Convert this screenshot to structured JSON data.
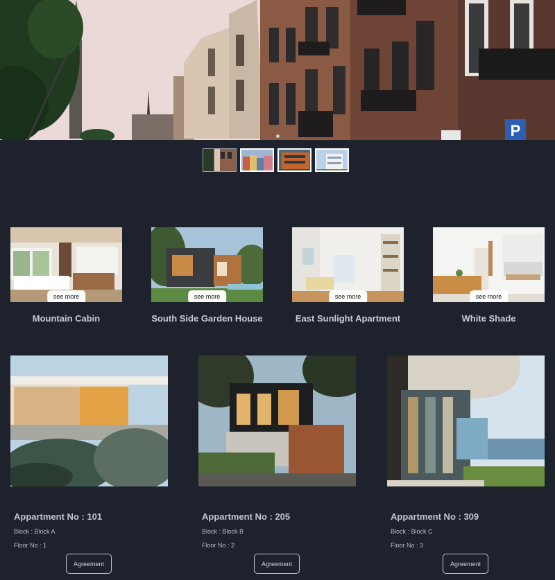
{
  "hero": {
    "slide_count": 4,
    "active_slide": 1
  },
  "thumbnails": [
    {
      "name": "street-row-houses"
    },
    {
      "name": "colorful-apartments"
    },
    {
      "name": "orange-balcony-building"
    },
    {
      "name": "white-modern-building"
    }
  ],
  "see_more_label": "see more",
  "properties": [
    {
      "title": "Mountain Cabin"
    },
    {
      "title": "South Side Garden House"
    },
    {
      "title": "East Sunlight Apartment"
    },
    {
      "title": "White Shade"
    }
  ],
  "apartments": [
    {
      "title": "Appartment No : 101",
      "block": "Block : Block A",
      "floor": "Floor No : 1",
      "button": "Agreement"
    },
    {
      "title": "Appartment No : 205",
      "block": "Block : Block B",
      "floor": "Floor No : 2",
      "button": "Agreement"
    },
    {
      "title": "Appartment No : 309",
      "block": "Block : Block C",
      "floor": "Floor No : 3",
      "button": "Agreement"
    }
  ],
  "colors": {
    "background": "#1d222d",
    "text": "#c9ccd3",
    "button_bg": "#ffffff"
  }
}
